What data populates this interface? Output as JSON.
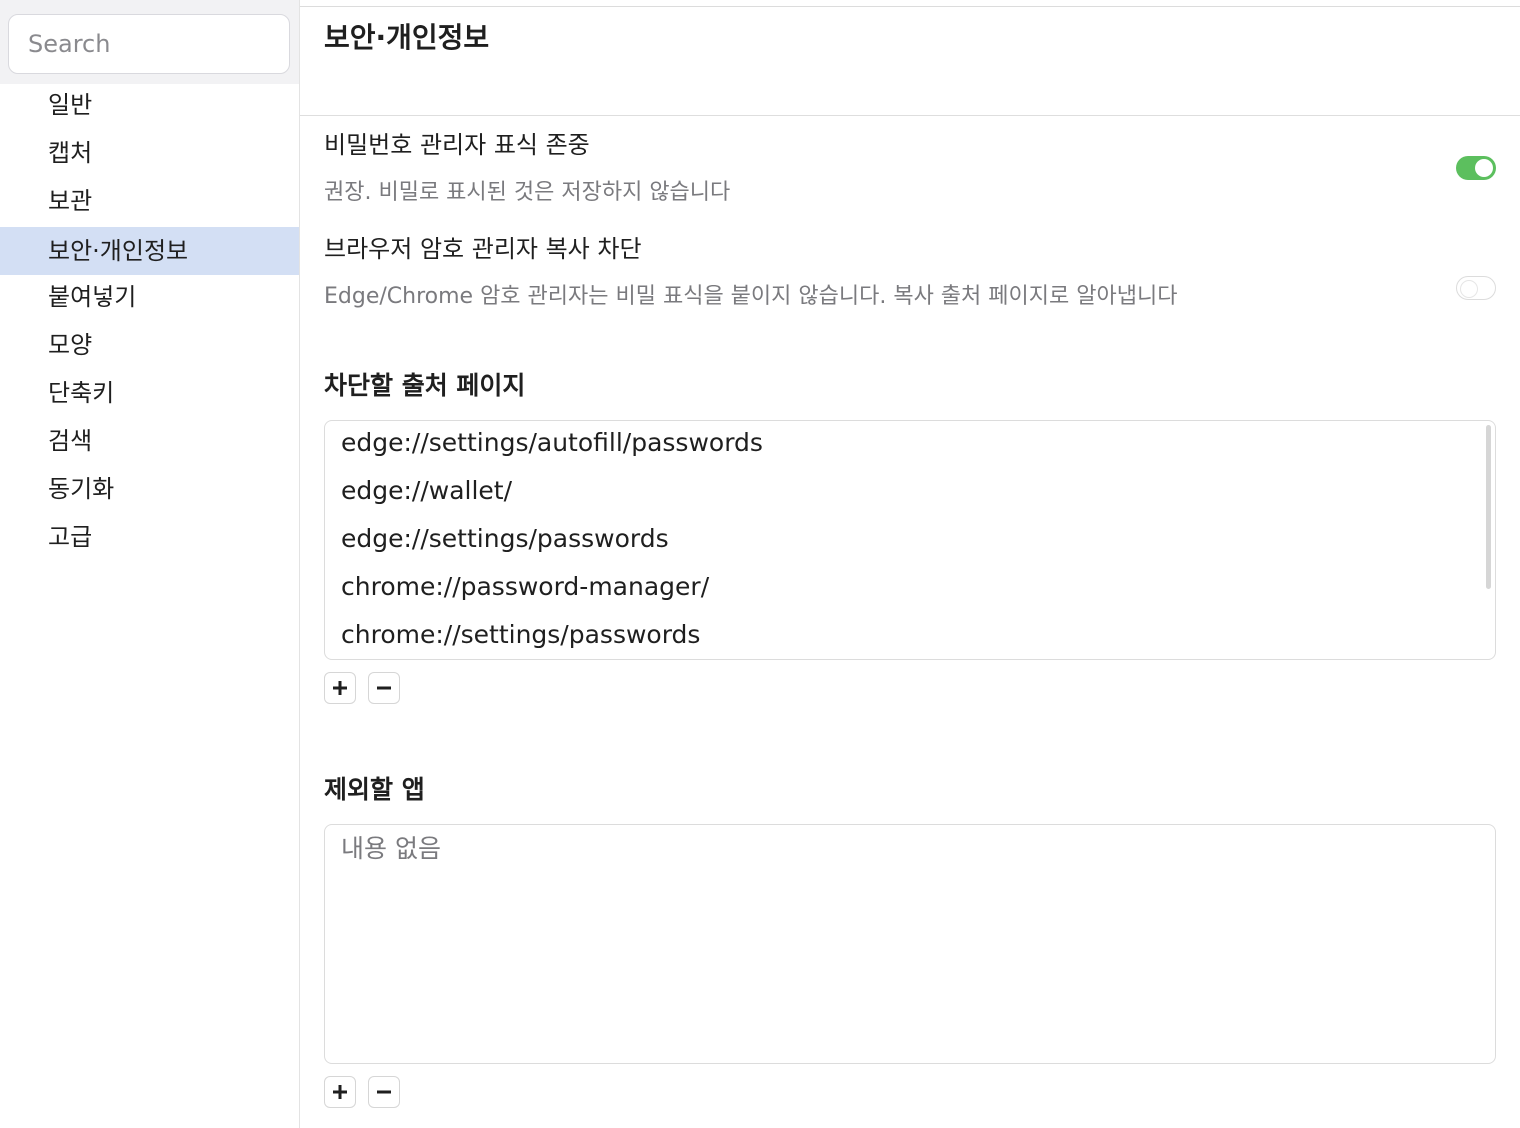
{
  "sidebar": {
    "search": {
      "placeholder": "Search",
      "value": ""
    },
    "items": [
      {
        "label": "일반"
      },
      {
        "label": "캡처"
      },
      {
        "label": "보관"
      },
      {
        "label": "보안·개인정보",
        "active": true
      },
      {
        "label": "붙여넣기"
      },
      {
        "label": "모양"
      },
      {
        "label": "단축키"
      },
      {
        "label": "검색"
      },
      {
        "label": "동기화"
      },
      {
        "label": "고급"
      }
    ]
  },
  "main": {
    "title": "보안·개인정보",
    "options": [
      {
        "title": "비밀번호 관리자 표식 존중",
        "description": "권장. 비밀로 표시된 것은 저장하지 않습니다",
        "enabled": true
      },
      {
        "title": "브라우저 암호 관리자 복사 차단",
        "description": "Edge/Chrome 암호 관리자는 비밀 표식을 붙이지 않습니다. 복사 출처 페이지로 알아냅니다",
        "enabled": false
      }
    ],
    "blocked_pages": {
      "title": "차단할 출처 페이지",
      "items": [
        "edge://settings/autofill/passwords",
        "edge://wallet/",
        "edge://settings/passwords",
        "chrome://password-manager/",
        "chrome://settings/passwords"
      ]
    },
    "excluded_apps": {
      "title": "제외할 앱",
      "empty_text": "내용 없음",
      "items": []
    },
    "icons": {
      "add": "plus-icon",
      "remove": "minus-icon"
    },
    "colors": {
      "toggle_on": "#5cbf5e",
      "selection": "#d3dff4"
    }
  }
}
